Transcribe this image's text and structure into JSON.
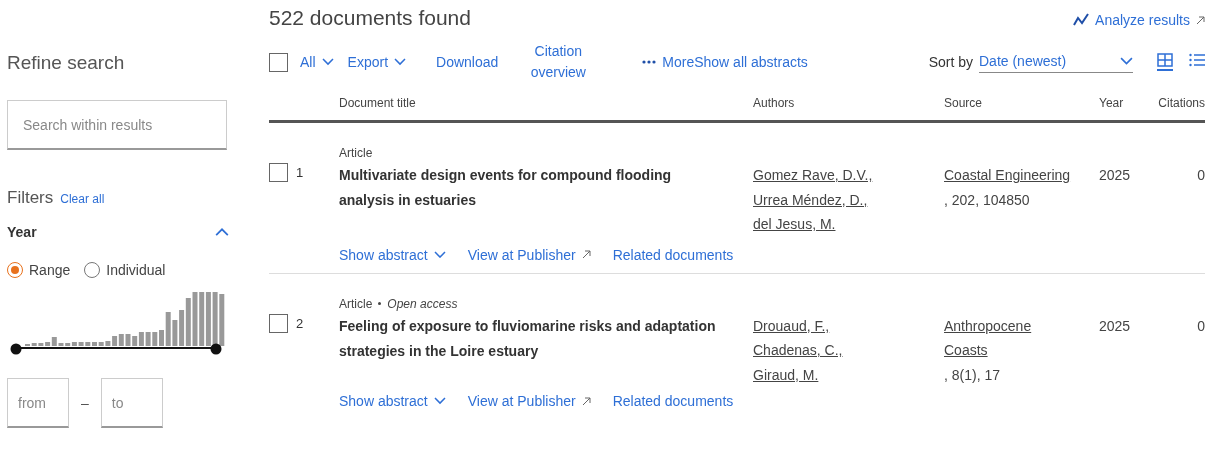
{
  "sidebar": {
    "title": "Refine search",
    "search": {
      "placeholder": "Search within results"
    },
    "filters_title": "Filters",
    "clear_all": "Clear all",
    "year": {
      "label": "Year",
      "expanded": true,
      "modes": [
        {
          "label": "Range",
          "selected": true
        },
        {
          "label": "Individual",
          "selected": false
        }
      ],
      "slider": [
        {
          "level": 0
        },
        {
          "level": 1
        }
      ],
      "from": {
        "placeholder": "from"
      },
      "separator": "–",
      "to": {
        "placeholder": "to"
      }
    }
  },
  "header": {
    "count": "522 documents found",
    "analyze": "Analyze results"
  },
  "toolbar": {
    "select_all": {
      "checked": false
    },
    "actions": [
      {
        "label": "All",
        "kind": "menu"
      },
      {
        "label": "Export",
        "kind": "menu"
      },
      {
        "label": "Download",
        "kind": "link"
      },
      {
        "label": "Citation overview",
        "kind": "wrap"
      },
      {
        "label": "More",
        "kind": "more"
      },
      {
        "label": "Show all abstracts",
        "kind": "link"
      }
    ],
    "sort_label": "Sort by",
    "sort_value": "Date (newest)",
    "views": [
      {
        "kind": "grid",
        "selected": true
      },
      {
        "kind": "list",
        "selected": false
      }
    ]
  },
  "table": {
    "columns": [
      "Document title",
      "Authors",
      "Source",
      "Year",
      "Citations"
    ],
    "rows": [
      {
        "number": "1",
        "checked": false,
        "type": "Article",
        "access": null,
        "title": "Multivariate design events for compound flooding analysis in estuaries",
        "authors": [
          "Gomez Rave, D.V.,",
          "Urrea Méndez, D.,",
          "del Jesus, M."
        ],
        "source_title": "Coastal Engineering",
        "source_details": ", 202, 104850",
        "year": "2025",
        "citations": "0",
        "links": [
          "Show abstract",
          "View at Publisher",
          "Related documents"
        ]
      },
      {
        "number": "2",
        "checked": false,
        "type": "Article",
        "access": "Open access",
        "title": "Feeling of exposure to fluviomarine risks and adaptation strategies in the Loire estuary",
        "authors": [
          "Drouaud, F.,",
          "Chadenas, C.,",
          "Giraud, M."
        ],
        "source_title": "Anthropocene Coasts",
        "source_details": ", 8(1), 17",
        "year": "2025",
        "citations": "0",
        "links": [
          "Show abstract",
          "View at Publisher",
          "Related documents"
        ]
      }
    ]
  }
}
